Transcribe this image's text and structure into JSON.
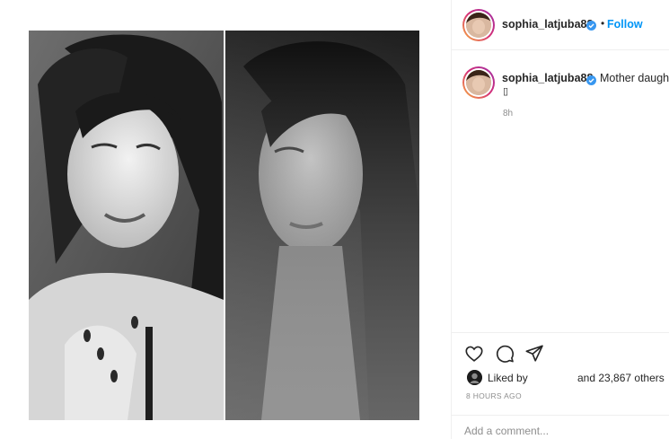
{
  "post": {
    "author": "sophia_latjuba88",
    "verified_icon": "verified-badge-icon",
    "follow_separator": "•",
    "follow_label": "Follow",
    "caption_text": "Mother daught",
    "caption_extra_glyph": "▯",
    "caption_time": "8h",
    "liked_by_label": "Liked by",
    "likes_count_text": "and 23,867 others",
    "timestamp": "8 HOURS AGO",
    "comment_placeholder": "Add a comment..."
  },
  "icons": {
    "like": "heart-icon",
    "comment": "comment-bubble-icon",
    "share": "paper-plane-icon"
  },
  "colors": {
    "link": "#0095f6",
    "verified": "#3897f0",
    "muted": "#8e8e8e",
    "text": "#262626"
  }
}
